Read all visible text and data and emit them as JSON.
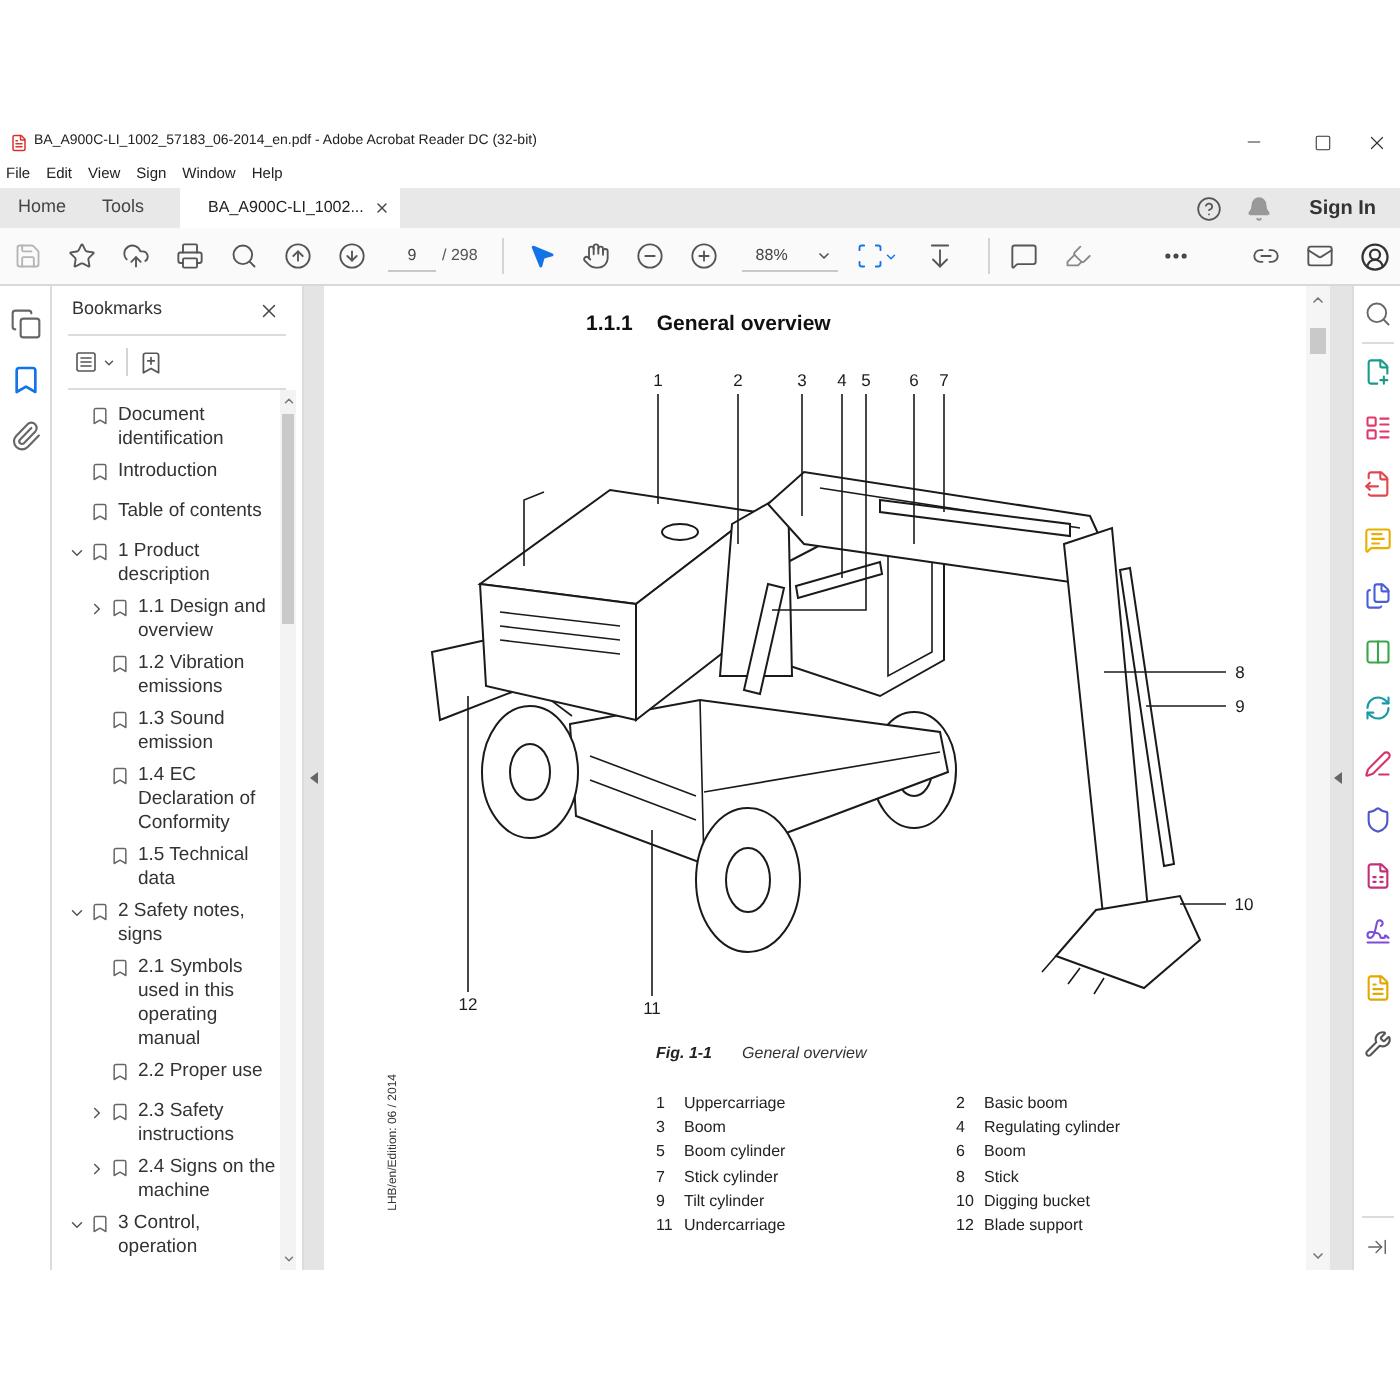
{
  "window": {
    "title": "BA_A900C-LI_1002_57183_06-2014_en.pdf - Adobe Acrobat Reader DC (32-bit)"
  },
  "menu": [
    "File",
    "Edit",
    "View",
    "Sign",
    "Window",
    "Help"
  ],
  "tabs": [
    {
      "label": "Home",
      "kind": "nav",
      "selected": false
    },
    {
      "label": "Tools",
      "kind": "nav",
      "selected": false
    },
    {
      "label": "BA_A900C-LI_1002...",
      "kind": "document",
      "selected": true
    }
  ],
  "account": {
    "sign_in": "Sign In"
  },
  "toolbar": {
    "page": "9",
    "page_count": "/ 298",
    "zoom": "88%",
    "pointer_tool": {
      "selected": true
    },
    "hand_tool": {
      "selected": false
    }
  },
  "side_rail": [
    {
      "selected": false
    },
    {
      "selected": true
    },
    {
      "selected": false
    }
  ],
  "bookmarks": {
    "title": "Bookmarks",
    "items": [
      {
        "label": "Document identification",
        "kind": "leaf"
      },
      {
        "label": "Introduction",
        "kind": "leaf"
      },
      {
        "label": "Table of contents",
        "kind": "leaf"
      },
      {
        "label": "1 Product description",
        "kind": "branch",
        "expanded": true,
        "children": [
          {
            "label": "1.1 Design and overview",
            "kind": "branch",
            "expanded": false
          },
          {
            "label": "1.2 Vibration emissions",
            "kind": "leaf"
          },
          {
            "label": "1.3 Sound emission",
            "kind": "leaf"
          },
          {
            "label": "1.4 EC Declaration of Conformity",
            "kind": "leaf"
          },
          {
            "label": "1.5 Technical data",
            "kind": "leaf"
          }
        ]
      },
      {
        "label": "2 Safety notes, signs",
        "kind": "branch",
        "expanded": true,
        "children": [
          {
            "label": "2.1 Symbols used in this operating manual",
            "kind": "leaf"
          },
          {
            "label": "2.2 Proper use",
            "kind": "leaf"
          },
          {
            "label": "2.3 Safety instructions",
            "kind": "branch",
            "expanded": false
          },
          {
            "label": "2.4 Signs on the machine",
            "kind": "branch",
            "expanded": false
          }
        ]
      },
      {
        "label": "3 Control, operation",
        "kind": "branch",
        "expanded": true
      }
    ]
  },
  "page": {
    "heading_number": "1.1.1",
    "heading": "General overview",
    "callouts": [
      "1",
      "2",
      "3",
      "4",
      "5",
      "6",
      "7",
      "8",
      "9",
      "10",
      "11",
      "12"
    ],
    "caption": {
      "label": "Fig. 1-1",
      "text": "General overview"
    },
    "legend": [
      {
        "number": "1",
        "label": "Uppercarriage"
      },
      {
        "number": "2",
        "label": "Basic boom"
      },
      {
        "number": "3",
        "label": "Boom"
      },
      {
        "number": "4",
        "label": "Regulating cylinder"
      },
      {
        "number": "5",
        "label": "Boom cylinder"
      },
      {
        "number": "6",
        "label": "Boom"
      },
      {
        "number": "7",
        "label": "Stick cylinder"
      },
      {
        "number": "8",
        "label": "Stick"
      },
      {
        "number": "9",
        "label": "Tilt cylinder"
      },
      {
        "number": "10",
        "label": "Digging bucket"
      },
      {
        "number": "11",
        "label": "Undercarriage"
      },
      {
        "number": "12",
        "label": "Blade support"
      }
    ],
    "side_note": "LHB/en/Edition: 06 / 2014"
  }
}
